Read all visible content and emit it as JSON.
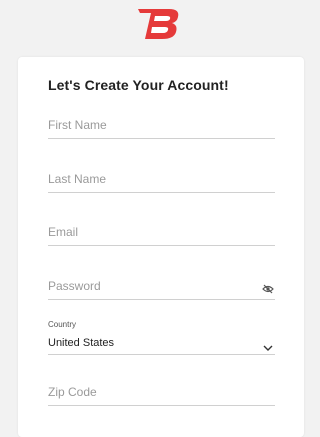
{
  "logo": {
    "letter": "B",
    "color": "#e53a3a"
  },
  "card": {
    "title": "Let's Create Your Account!",
    "fields": {
      "first_name": {
        "placeholder": "First Name"
      },
      "last_name": {
        "placeholder": "Last Name"
      },
      "email": {
        "placeholder": "Email"
      },
      "password": {
        "placeholder": "Password",
        "visibility_icon": "eye-off-icon"
      },
      "country": {
        "label": "Country",
        "value": "United States",
        "dropdown_icon": "chevron-down-icon"
      },
      "zip": {
        "placeholder": "Zip Code"
      }
    }
  }
}
